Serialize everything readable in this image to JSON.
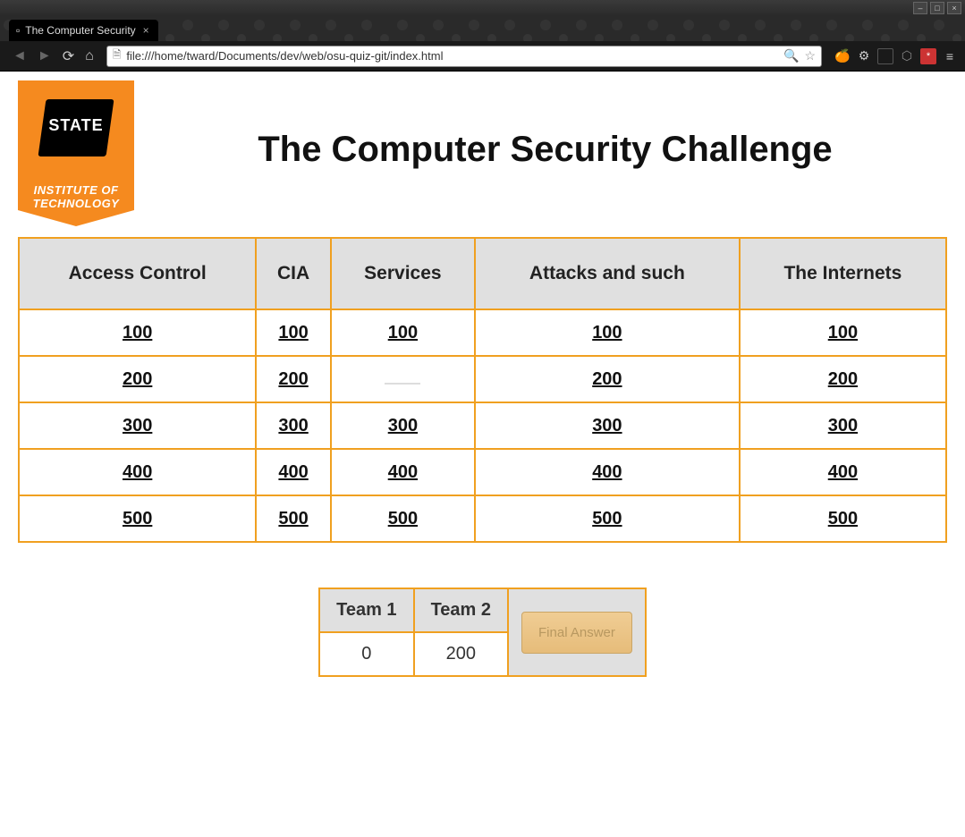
{
  "os": {
    "minimize": "–",
    "maximize": "□",
    "close": "×"
  },
  "browser": {
    "tab_title": "The Computer Security",
    "url": "file:///home/tward/Documents/dev/web/osu-quiz-git/index.html"
  },
  "logo": {
    "state": "STATE",
    "institute_line1": "INSTITUTE OF",
    "institute_line2": "TECHNOLOGY"
  },
  "page": {
    "title": "The Computer Security Challenge"
  },
  "board": {
    "categories": [
      "Access Control",
      "CIA",
      "Services",
      "Attacks and such",
      "The Internets"
    ],
    "rows": [
      [
        {
          "label": "100",
          "used": false
        },
        {
          "label": "100",
          "used": false
        },
        {
          "label": "100",
          "used": false
        },
        {
          "label": "100",
          "used": false
        },
        {
          "label": "100",
          "used": false
        }
      ],
      [
        {
          "label": "200",
          "used": false
        },
        {
          "label": "200",
          "used": false
        },
        {
          "label": "",
          "used": true
        },
        {
          "label": "200",
          "used": false
        },
        {
          "label": "200",
          "used": false
        }
      ],
      [
        {
          "label": "300",
          "used": false
        },
        {
          "label": "300",
          "used": false
        },
        {
          "label": "300",
          "used": false
        },
        {
          "label": "300",
          "used": false
        },
        {
          "label": "300",
          "used": false
        }
      ],
      [
        {
          "label": "400",
          "used": false
        },
        {
          "label": "400",
          "used": false
        },
        {
          "label": "400",
          "used": false
        },
        {
          "label": "400",
          "used": false
        },
        {
          "label": "400",
          "used": false
        }
      ],
      [
        {
          "label": "500",
          "used": false
        },
        {
          "label": "500",
          "used": false
        },
        {
          "label": "500",
          "used": false
        },
        {
          "label": "500",
          "used": false
        },
        {
          "label": "500",
          "used": false
        }
      ]
    ]
  },
  "score": {
    "teams": [
      {
        "name": "Team 1",
        "score": "0"
      },
      {
        "name": "Team 2",
        "score": "200"
      }
    ],
    "final_label": "Final Answer"
  }
}
